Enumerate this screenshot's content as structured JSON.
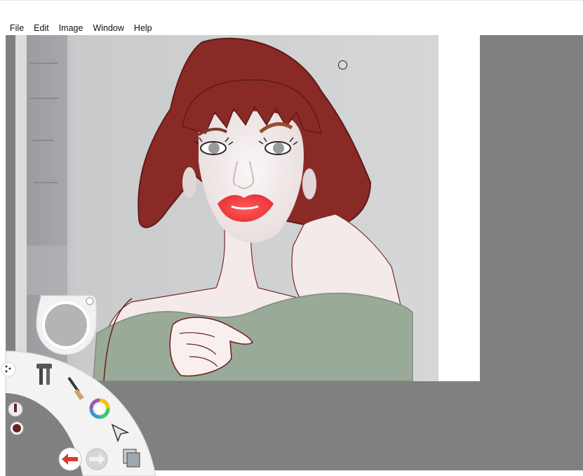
{
  "menubar": {
    "items": [
      "File",
      "Edit",
      "Image",
      "Window",
      "Help"
    ]
  },
  "colors": {
    "workspace": "#808080",
    "hair": "#8a2a27",
    "lips": "#ef3b3b",
    "sweater": "#9aaa98",
    "skin": "#f6eeee",
    "current_color": "#6b1f1f"
  },
  "toolbar": {
    "tools": [
      "tools-icon",
      "brush-icon",
      "color-wheel-icon",
      "select-arrow-icon",
      "layers-icon",
      "undo-icon",
      "redo-icon"
    ],
    "current_brush": "brush-preview-icon"
  }
}
